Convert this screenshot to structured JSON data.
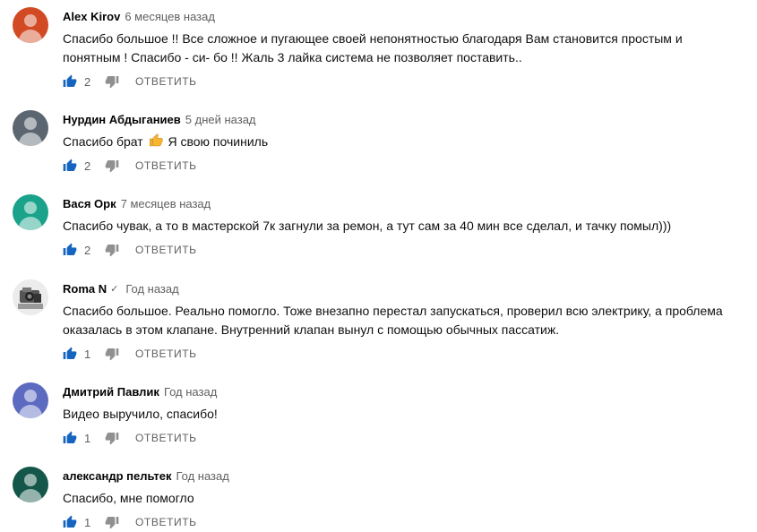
{
  "reply_label": "ОТВЕТИТЬ",
  "comments": [
    {
      "author": "Alex Kirov",
      "time": "6 месяцев назад",
      "text": "Спасибо большое !! Все сложное и пугающее своей непонятностью благодаря Вам становится простым и понятным ! Спасибо - си- бо !! Жаль 3 лайка система не позволяет поставить..",
      "likes": "2",
      "avatar_color": "#d14a23"
    },
    {
      "author": "Нурдин Абдыганиев",
      "time": "5 дней назад",
      "text_before": "Спасибо брат",
      "text_emoji": "thumbs-up-emoji",
      "text_after": "Я свою починиль",
      "likes": "2",
      "avatar_color": "#5b6670"
    },
    {
      "author": "Вася Орк",
      "time": "7 месяцев назад",
      "text": "Спасибо чувак, а то  в мастерской 7к загнули за ремон, а тут сам за 40 мин все сделал, и тачку помыл)))",
      "likes": "2",
      "avatar_color": "#1aa38a"
    },
    {
      "author": "Roma N",
      "verified_icon": "check-icon",
      "time": "Год назад",
      "text": "Спасибо большое. Реально помогло. Тоже внезапно перестал запускаться, проверил всю электрику, а проблема оказалась в этом клапане. Внутренний клапан вынул с помощью обычных пассатиж.",
      "likes": "1",
      "avatar_color": "#e8e8e8"
    },
    {
      "author": "Дмитрий Павлик",
      "time": "Год назад",
      "text": "Видео выручило, спасибо!",
      "likes": "1",
      "avatar_color": "#5c6bc0"
    },
    {
      "author": "александр пельтек",
      "time": "Год назад",
      "text": "Спасибо, мне помогло",
      "likes": "1",
      "avatar_color": "#14574a"
    }
  ]
}
